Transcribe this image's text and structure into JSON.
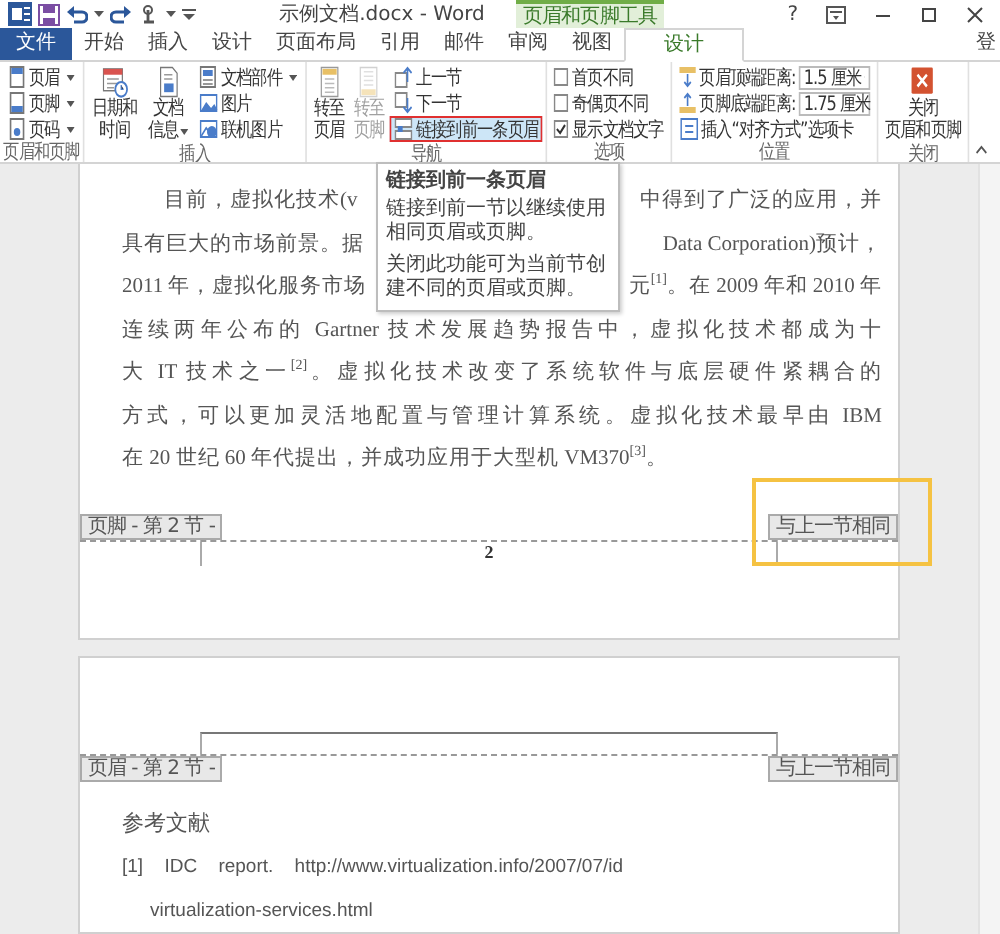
{
  "window": {
    "title": "示例文档.docx - Word",
    "context_label": "页眉和页脚工具",
    "help": "?"
  },
  "tabs": [
    {
      "label": "文件",
      "kind": "file",
      "selected": false
    },
    {
      "label": "开始",
      "kind": "normal",
      "selected": false
    },
    {
      "label": "插入",
      "kind": "normal",
      "selected": false
    },
    {
      "label": "设计",
      "kind": "normal",
      "selected": false
    },
    {
      "label": "页面布局",
      "kind": "normal",
      "selected": false
    },
    {
      "label": "引用",
      "kind": "normal",
      "selected": false
    },
    {
      "label": "邮件",
      "kind": "normal",
      "selected": false
    },
    {
      "label": "审阅",
      "kind": "normal",
      "selected": false
    },
    {
      "label": "视图",
      "kind": "normal",
      "selected": false
    },
    {
      "label": "设计",
      "kind": "context",
      "selected": true
    }
  ],
  "account": "登",
  "ribbon_groups": [
    {
      "label": "页眉和页脚",
      "items": [
        {
          "kind": "small",
          "label": "页眉",
          "dropdown": true
        },
        {
          "kind": "small",
          "label": "页脚",
          "dropdown": true
        },
        {
          "kind": "small",
          "label": "页码",
          "dropdown": true
        }
      ]
    },
    {
      "label": "插入",
      "items": [
        {
          "kind": "large",
          "label": "日期和时间",
          "dropdown": false
        },
        {
          "kind": "large",
          "label": "文档信息",
          "dropdown": true
        },
        {
          "kind": "small",
          "label": "文档部件",
          "dropdown": true
        },
        {
          "kind": "small",
          "label": "图片",
          "dropdown": false
        },
        {
          "kind": "small",
          "label": "联机图片",
          "dropdown": false
        }
      ]
    },
    {
      "label": "导航",
      "items": [
        {
          "kind": "large",
          "label": "转至页眉",
          "disabled": false,
          "on": false
        },
        {
          "kind": "large",
          "label": "转至页脚",
          "disabled": true,
          "on": false
        },
        {
          "kind": "small",
          "label": "上一节",
          "disabled": false,
          "on": false
        },
        {
          "kind": "small",
          "label": "下一节",
          "disabled": false,
          "on": false
        },
        {
          "kind": "small",
          "label": "链接到前一条页眉",
          "disabled": false,
          "on": true
        }
      ]
    },
    {
      "label": "选项",
      "items": [
        {
          "kind": "check",
          "label": "首页不同",
          "checked": false
        },
        {
          "kind": "check",
          "label": "奇偶页不同",
          "checked": false
        },
        {
          "kind": "check",
          "label": "显示文档文字",
          "checked": true
        }
      ]
    },
    {
      "label": "位置",
      "items": [
        {
          "kind": "spin",
          "label": "页眉顶端距离:",
          "value": "1.5 厘米"
        },
        {
          "kind": "spin",
          "label": "页脚底端距离:",
          "value": "1.75 厘米"
        },
        {
          "kind": "small",
          "label": "插入“对齐方式”选项卡"
        }
      ]
    },
    {
      "label": "关闭",
      "items": [
        {
          "kind": "large",
          "lines": [
            "关闭",
            "页眉和页脚"
          ]
        }
      ]
    }
  ],
  "tooltip": {
    "title": "链接到前一条页眉",
    "paragraphs": [
      "链接到前一节以继续使用相同页眉或页脚。",
      "关闭此功能可为当前节创建不同的页眉或页脚。"
    ]
  },
  "pages": [
    {
      "lines": [
        {
          "kind": "split",
          "indent": true,
          "left": "目前，虚拟化技术(v",
          "right": "中得到了广泛的应用，并"
        },
        {
          "kind": "split",
          "indent": false,
          "left": "具有巨大的市场前景。据",
          "right": "Data Corporation)预计，"
        },
        {
          "kind": "split",
          "indent": false,
          "left": "2011 年，虚拟化服务市场",
          "right": "元$^{[1]}$。在 2009 年和 2010 年"
        },
        {
          "kind": "full",
          "text": "连续两年公布的 Gartner 技术发展趋势报告中，虚拟化技术都成为十"
        },
        {
          "kind": "full",
          "text": "大 IT 技术之一$^{[2]}$。虚拟化技术改变了系统软件与底层硬件紧耦合的"
        },
        {
          "kind": "full",
          "text": "方式，可以更加灵活地配置与管理计算系统。虚拟化技术最早由 IBM"
        },
        {
          "kind": "end",
          "text": "在 20 世纪 60 年代提出，并成功应用于大型机 VM370$^{[3]}$。"
        }
      ],
      "footer": {
        "label": "页脚 - 第 2 节 -",
        "link": "与上一节相同",
        "page_number": "2"
      }
    },
    {
      "header": {
        "label": "页眉 - 第 2 节 -",
        "link": "与上一节相同"
      },
      "lines": [
        {
          "kind": "heading",
          "text": "参考文献"
        },
        {
          "kind": "ref",
          "text": "[1] IDC report. http://www.virtualization.info/2007/07/id"
        },
        {
          "kind": "ref-cont",
          "text": "virtualization-services.html"
        }
      ]
    }
  ]
}
